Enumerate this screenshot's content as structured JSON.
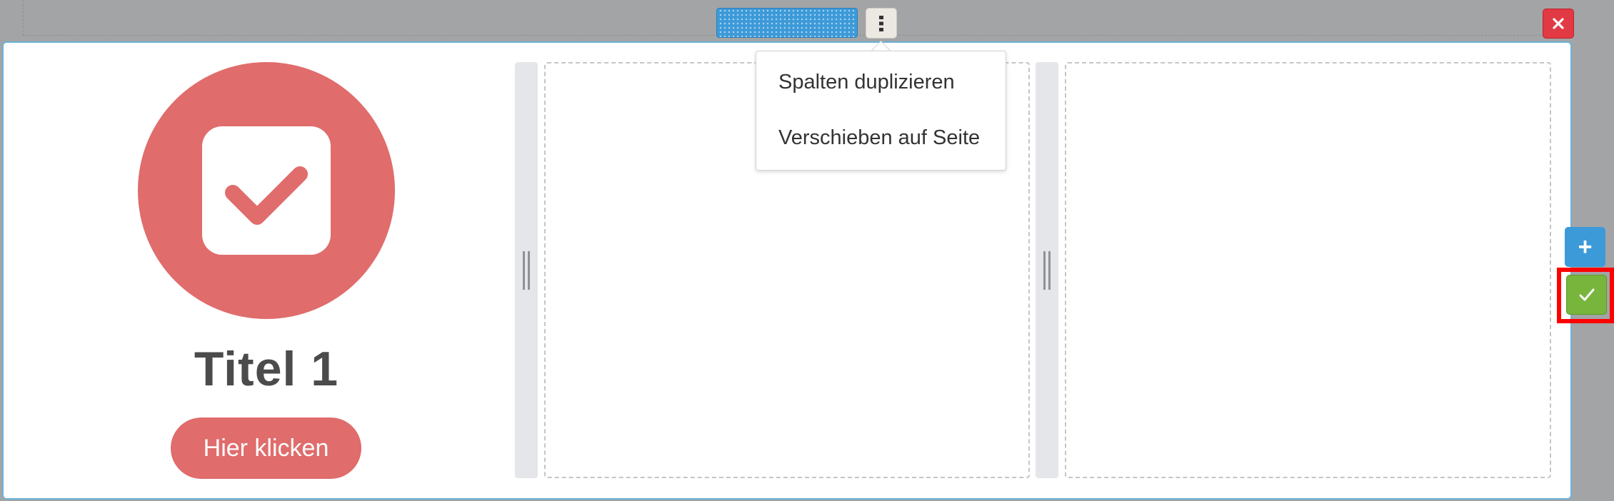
{
  "toolbar": {
    "drag_handle_icon": "drag-handle-icon",
    "options_icon": "kebab-vertical-icon",
    "close_icon": "close-icon"
  },
  "column1": {
    "icon": "checkbox-checked-icon",
    "title": "Titel 1",
    "button_label": "Hier klicken"
  },
  "context_menu": {
    "items": [
      {
        "label": "Spalten duplizieren"
      },
      {
        "label": "Verschieben auf Seite"
      }
    ]
  },
  "side_actions": {
    "add_label": "+",
    "confirm_icon": "checkmark-icon"
  },
  "colors": {
    "accent_blue": "#3d9ad9",
    "brand_red": "#e06c6c",
    "confirm_green": "#77b53c",
    "close_red": "#e23a44"
  }
}
